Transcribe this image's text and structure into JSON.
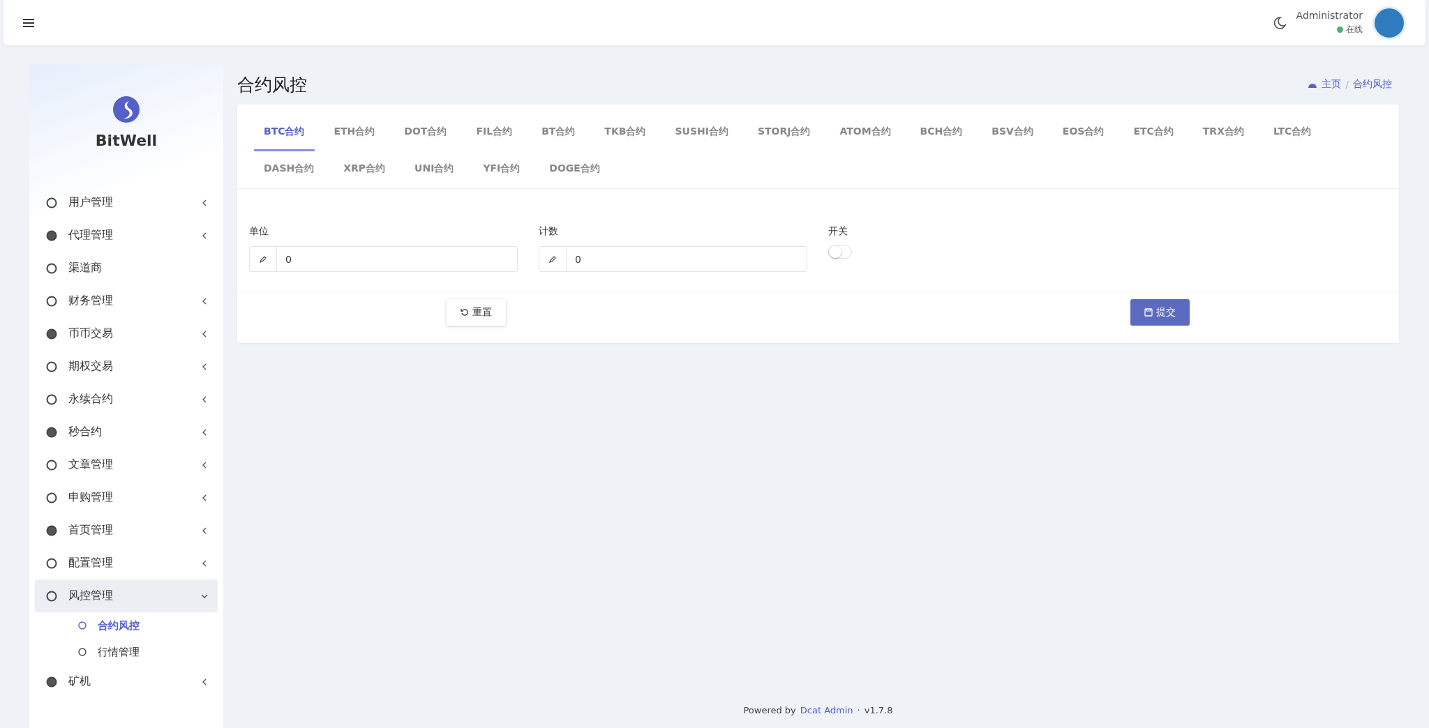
{
  "topbar": {
    "user": "Administrator",
    "status": "在线",
    "online": true
  },
  "sidebar": {
    "brand": "BitWell",
    "items": [
      {
        "label": "用户管理",
        "expanded": false,
        "selected": false
      },
      {
        "label": "代理管理",
        "expanded": false,
        "selected": false
      },
      {
        "label": "渠道商",
        "selected": false
      },
      {
        "label": "财务管理",
        "expanded": false,
        "selected": false
      },
      {
        "label": "币币交易",
        "expanded": false,
        "selected": false
      },
      {
        "label": "期权交易",
        "expanded": false,
        "selected": false
      },
      {
        "label": "永续合约",
        "expanded": false,
        "selected": false
      },
      {
        "label": "秒合约",
        "expanded": false,
        "selected": false
      },
      {
        "label": "文章管理",
        "expanded": false,
        "selected": false
      },
      {
        "label": "申购管理",
        "expanded": false,
        "selected": false
      },
      {
        "label": "首页管理",
        "expanded": false,
        "selected": false
      },
      {
        "label": "配置管理",
        "expanded": false,
        "selected": false
      },
      {
        "label": "风控管理",
        "expanded": true,
        "selected": true,
        "children": [
          {
            "label": "合约风控",
            "selected": true
          },
          {
            "label": "行情管理",
            "selected": false
          }
        ]
      },
      {
        "label": "矿机",
        "expanded": false,
        "selected": false
      }
    ]
  },
  "page": {
    "title": "合约风控",
    "breadcrumb": [
      "主页",
      "合约风控"
    ],
    "breadcrumb_separator": "/"
  },
  "tabs": [
    {
      "label": "BTC合约",
      "selected": true
    },
    {
      "label": "ETH合约",
      "selected": false
    },
    {
      "label": "DOT合约",
      "selected": false
    },
    {
      "label": "FIL合约",
      "selected": false
    },
    {
      "label": "BT合约",
      "selected": false
    },
    {
      "label": "TKB合约",
      "selected": false
    },
    {
      "label": "SUSHI合约",
      "selected": false
    },
    {
      "label": "STORJ合约",
      "selected": false
    },
    {
      "label": "ATOM合约",
      "selected": false
    },
    {
      "label": "BCH合约",
      "selected": false
    },
    {
      "label": "BSV合约",
      "selected": false
    },
    {
      "label": "EOS合约",
      "selected": false
    },
    {
      "label": "ETC合约",
      "selected": false
    },
    {
      "label": "TRX合约",
      "selected": false
    },
    {
      "label": "LTC合约",
      "selected": false
    },
    {
      "label": "DASH合约",
      "selected": false
    },
    {
      "label": "XRP合约",
      "selected": false
    },
    {
      "label": "UNI合约",
      "selected": false
    },
    {
      "label": "YFI合约",
      "selected": false
    },
    {
      "label": "DOGE合约",
      "selected": false
    }
  ],
  "form": {
    "fields": [
      {
        "kind": "input",
        "label": "单位",
        "value": "0"
      },
      {
        "kind": "input",
        "label": "计数",
        "value": "0"
      },
      {
        "kind": "switch",
        "label": "开关",
        "on": false
      }
    ],
    "buttons": [
      {
        "kind": "reset",
        "label": "重置"
      },
      {
        "kind": "submit",
        "label": "提交"
      }
    ]
  },
  "footer": {
    "prefix": "Powered by",
    "link": "Dcat Admin",
    "separator": "·",
    "version": "v1.7.8"
  }
}
